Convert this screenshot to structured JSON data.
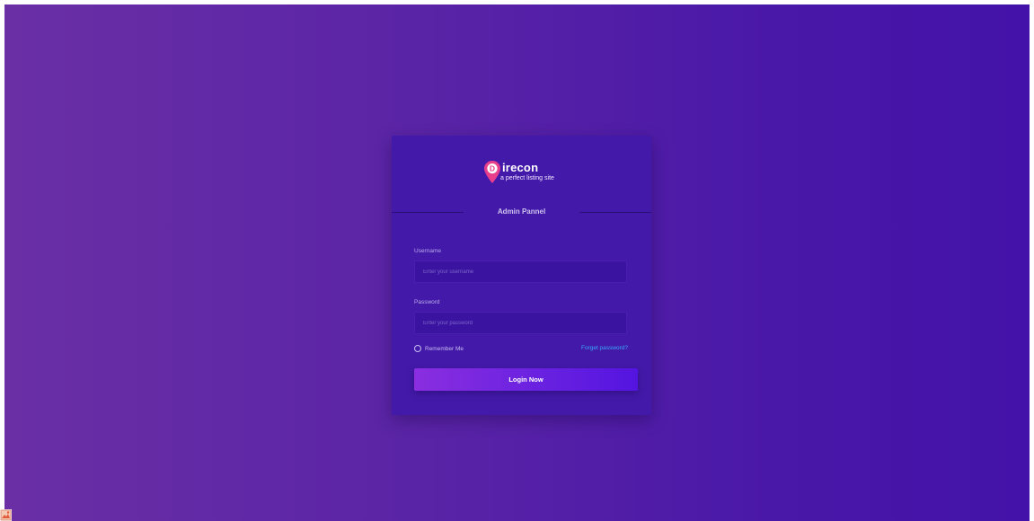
{
  "brand": {
    "logo_letter": "D",
    "name": "irecon",
    "tagline": "a perfect listing site",
    "pin_color": "#e83e8c"
  },
  "panel": {
    "title": "Admin Pannel"
  },
  "form": {
    "username_label": "Username",
    "username_placeholder": "Enter your username",
    "password_label": "Password",
    "password_placeholder": "Enter your password",
    "remember_label": "Remember Me",
    "forgot_label": "Forget password?",
    "login_label": "Login Now"
  },
  "colors": {
    "background_start": "#6a2fa5",
    "background_end": "#4312a8",
    "card": "#4319a9",
    "link": "#3aa7ff"
  }
}
